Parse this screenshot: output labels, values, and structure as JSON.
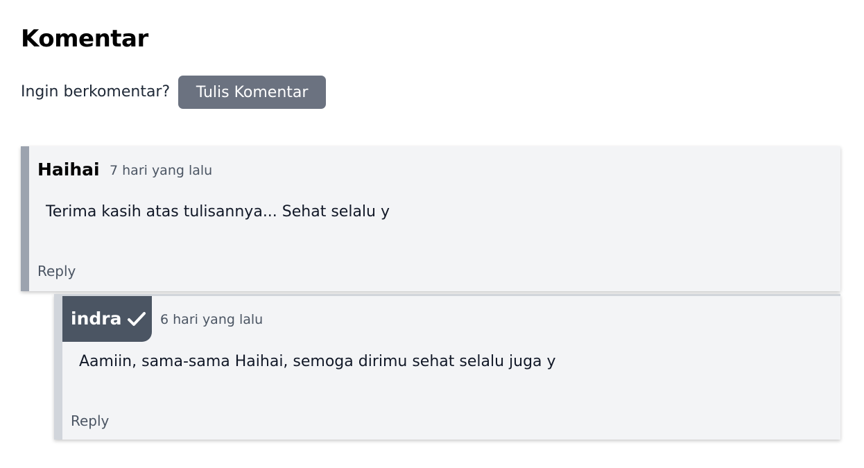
{
  "section": {
    "title": "Komentar",
    "prompt": "Ingin berkomentar?",
    "write_button": "Tulis Komentar"
  },
  "comments": [
    {
      "author": "Haihai",
      "time": "7 hari yang lalu",
      "body": "Terima kasih atas tulisannya... Sehat selalu y",
      "reply_label": "Reply"
    },
    {
      "author": "indra",
      "verified_icon": "check-icon",
      "time": "6 hari yang lalu",
      "body": "Aamiin, sama-sama Haihai, semoga dirimu sehat selalu juga y",
      "reply_label": "Reply"
    }
  ],
  "colors": {
    "button_bg": "#6b7280",
    "author_badge_bg": "#4b5563",
    "comment_bg": "#f3f4f6",
    "comment_border": "#9ca3af",
    "reply_border": "#d1d5db"
  }
}
